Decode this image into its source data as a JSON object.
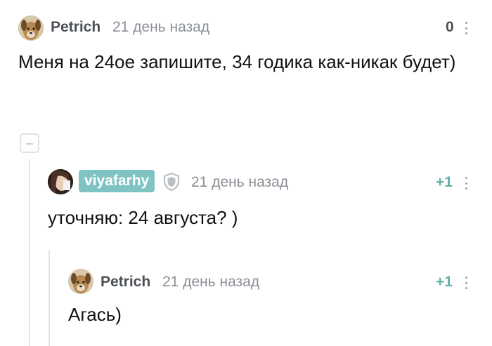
{
  "comments": [
    {
      "username": "Petrich",
      "time": "21 день назад",
      "rating": "0",
      "text": "Меня на 24ое запишите, 34 годика как-никак будет)"
    },
    {
      "username": "viyafarhy",
      "time": "21 день назад",
      "rating": "+1",
      "text": "уточняю: 24 августа? )",
      "badge_color": "#7fc4c2"
    },
    {
      "username": "Petrich",
      "time": "21 день назад",
      "rating": "+1",
      "text": "Агась)"
    }
  ],
  "colors": {
    "positive": "#5fb2ab",
    "neutral": "#4b4f56"
  }
}
